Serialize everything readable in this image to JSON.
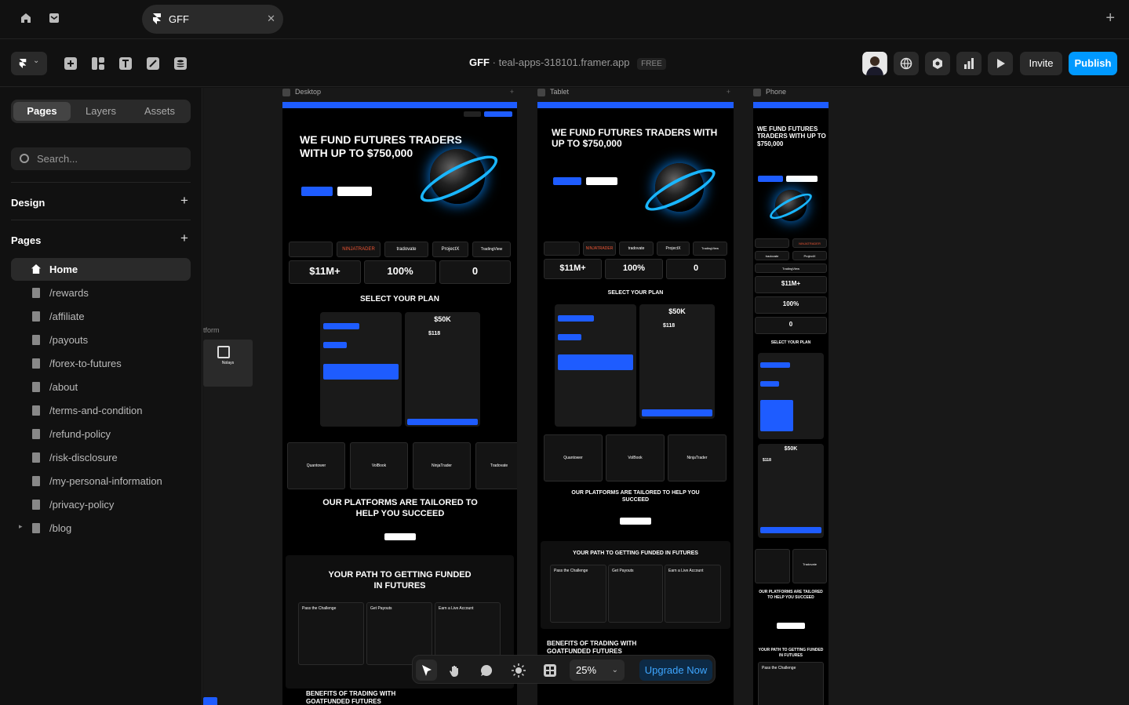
{
  "tabs": [
    {
      "label": "GFF"
    }
  ],
  "toolbar": {
    "project_name": "GFF",
    "domain": "teal-apps-318101.framer.app",
    "plan_badge": "FREE",
    "invite_label": "Invite",
    "publish_label": "Publish"
  },
  "sidebar": {
    "tabs": [
      "Pages",
      "Layers",
      "Assets"
    ],
    "active_tab": "Pages",
    "search_placeholder": "Search...",
    "design_label": "Design",
    "pages_label": "Pages",
    "pages": [
      "Home",
      "/rewards",
      "/affiliate",
      "/payouts",
      "/forex-to-futures",
      "/about",
      "/terms-and-condition",
      "/refund-policy",
      "/risk-disclosure",
      "/my-personal-information",
      "/privacy-policy",
      "/blog"
    ],
    "selected_page": "Home"
  },
  "canvas": {
    "frames": [
      {
        "label": "Desktop"
      },
      {
        "label": "Tablet"
      },
      {
        "label": "Phone"
      }
    ],
    "offcanvas_label": "tform",
    "mini_label": "Nolays",
    "site": {
      "hero_desktop": "WE FUND FUTURES TRADERS WITH UP TO $750,000",
      "hero_tablet": "WE FUND FUTURES TRADERS WITH UP TO $750,000",
      "hero_phone": "WE FUND FUTURES TRADERS WITH UP TO $750,000",
      "stats": [
        "$11M+",
        "100%",
        "0"
      ],
      "select_plan": "SELECT YOUR PLAN",
      "plan_price": "$50K",
      "plan_cost": "$118",
      "platforms_desktop": "OUR PLATFORMS ARE TAILORED TO HELP YOU SUCCEED",
      "path_desktop": "YOUR PATH TO GETTING FUNDED IN FUTURES",
      "benefits_desktop": "BENEFITS OF TRADING WITH GOATFUNDED FUTURES",
      "platforms_tablet": "OUR PLATFORMS ARE TAILORED TO HELP YOU SUCCEED",
      "path_tablet": "YOUR PATH TO GETTING FUNDED IN FUTURES",
      "benefits_tablet": "BENEFITS OF TRADING WITH GOATFUNDED FUTURES",
      "select_plan_phone": "SELECT YOUR PLAN",
      "platforms_phone": "OUR PLATFORMS ARE TAILORED TO HELP YOU SUCCEED",
      "path_phone": "YOUR PATH TO GETTING FUNDED IN FUTURES",
      "steps": [
        "Pass the Challenge",
        "Get Payouts",
        "Earn a Live Account"
      ],
      "platform_names": [
        "Quantower",
        "VolBook",
        "NinjaTrader",
        "Tradovate"
      ],
      "brands": [
        "NINJATRADER",
        "tradovate",
        "ProjectX",
        "TradingView"
      ]
    }
  },
  "bottom_toolbar": {
    "zoom": "25%",
    "upgrade_label": "Upgrade Now"
  },
  "colors": {
    "accent": "#0099ff",
    "site_blue": "#1e5cff",
    "bg": "#111111"
  }
}
